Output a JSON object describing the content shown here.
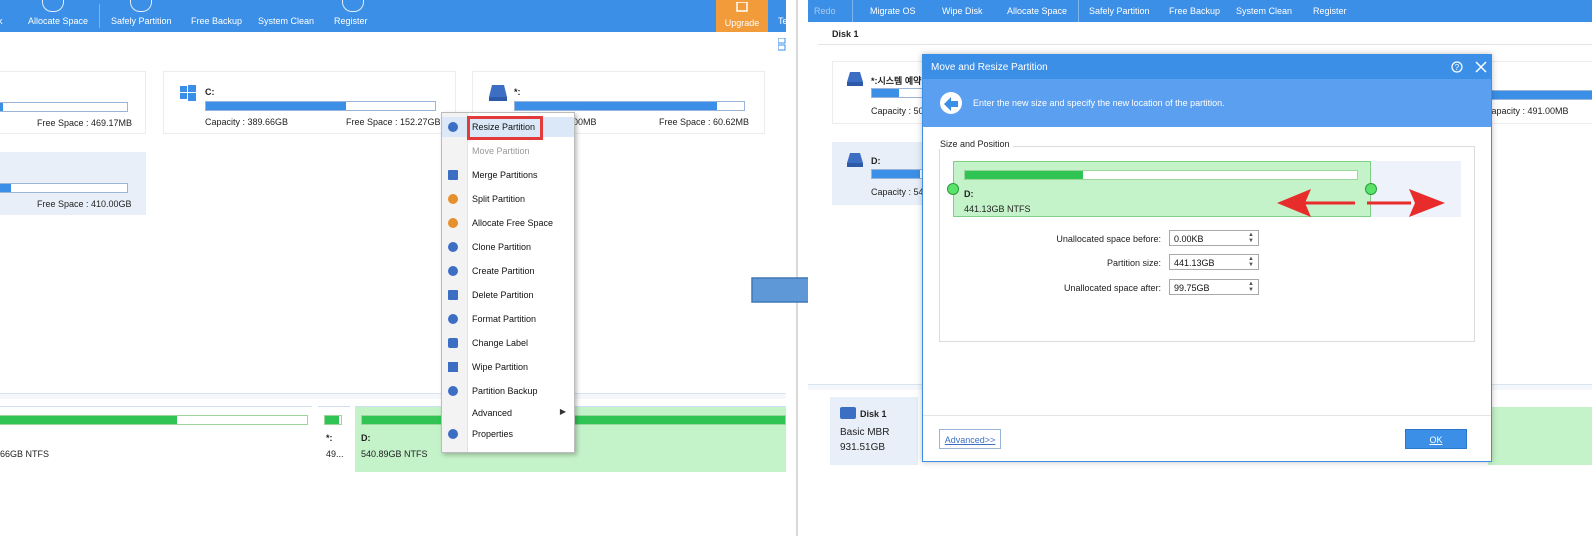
{
  "left": {
    "toolbar": {
      "items": [
        "k",
        "Allocate Space",
        "Safely Partition",
        "Free Backup",
        "System Clean",
        "Register"
      ],
      "upgrade": "Upgrade",
      "cut_item": "Te"
    },
    "cards": {
      "partial_top_free": "Free Space : 469.17MB",
      "c_name": "C:",
      "c_capacity": "Capacity : 389.66GB",
      "c_free": "Free Space : 152.27GB",
      "star_name": "*:",
      "star_capacity_partial": "00MB",
      "star_free": "Free Space : 60.62MB",
      "partial_bottom_free": "Free Space : 410.00GB"
    },
    "context_menu": {
      "items": [
        {
          "label": "Resize Partition",
          "state": "highlighted"
        },
        {
          "label": "Move Partition",
          "state": "disabled"
        },
        {
          "label": "Merge Partitions",
          "state": "normal"
        },
        {
          "label": "Split Partition",
          "state": "normal"
        },
        {
          "label": "Allocate Free Space",
          "state": "normal"
        },
        {
          "label": "Clone Partition",
          "state": "normal"
        },
        {
          "label": "Create Partition",
          "state": "normal"
        },
        {
          "label": "Delete Partition",
          "state": "normal"
        },
        {
          "label": "Format Partition",
          "state": "normal"
        },
        {
          "label": "Change Label",
          "state": "normal"
        },
        {
          "label": "Wipe Partition",
          "state": "normal"
        },
        {
          "label": "Partition Backup",
          "state": "normal"
        },
        {
          "label": "Advanced",
          "state": "submenu"
        },
        {
          "label": "Properties",
          "state": "normal"
        }
      ]
    },
    "map": {
      "lane1_label": "66GB NTFS",
      "lane2_name": "*:",
      "lane2_size": "49...",
      "lane3_name": "D:",
      "lane3_size": "540.89GB NTFS"
    }
  },
  "right": {
    "toolbar": {
      "items": [
        "Redo",
        "Migrate OS",
        "Wipe Disk",
        "Allocate Space",
        "Safely Partition",
        "Free Backup",
        "System Clean",
        "Register"
      ]
    },
    "disk_header": "Disk 1",
    "bg": {
      "card1_name": "*:시스템 예약",
      "card1_capacity_partial": "Capacity : 50",
      "card2_name": "D:",
      "card2_capacity_partial": "Capacity : 54",
      "right_capacity_partial": "Capacity : 491.00MB",
      "right_star_partial": "*",
      "disk_name": "Disk 1",
      "disk_type": "Basic MBR",
      "disk_size": "931.51GB"
    },
    "dialog": {
      "title": "Move and Resize Partition",
      "subtitle": "Enter the new size and specify the new location of the partition.",
      "section": "Size and Position",
      "partition_name": "D:",
      "partition_desc": "441.13GB NTFS",
      "fields": [
        {
          "label": "Unallocated space before:",
          "value": "0.00KB"
        },
        {
          "label": "Partition size:",
          "value": "441.13GB"
        },
        {
          "label": "Unallocated space after:",
          "value": "99.75GB"
        }
      ],
      "advanced": "Advanced>>",
      "ok": "OK"
    }
  },
  "colors": {
    "accent": "#3c8fe6",
    "highlight_box": "#e33b3b",
    "used_green": "#2fc454",
    "partition_bg": "#c4f2c9",
    "upgrade": "#f29b3a"
  }
}
